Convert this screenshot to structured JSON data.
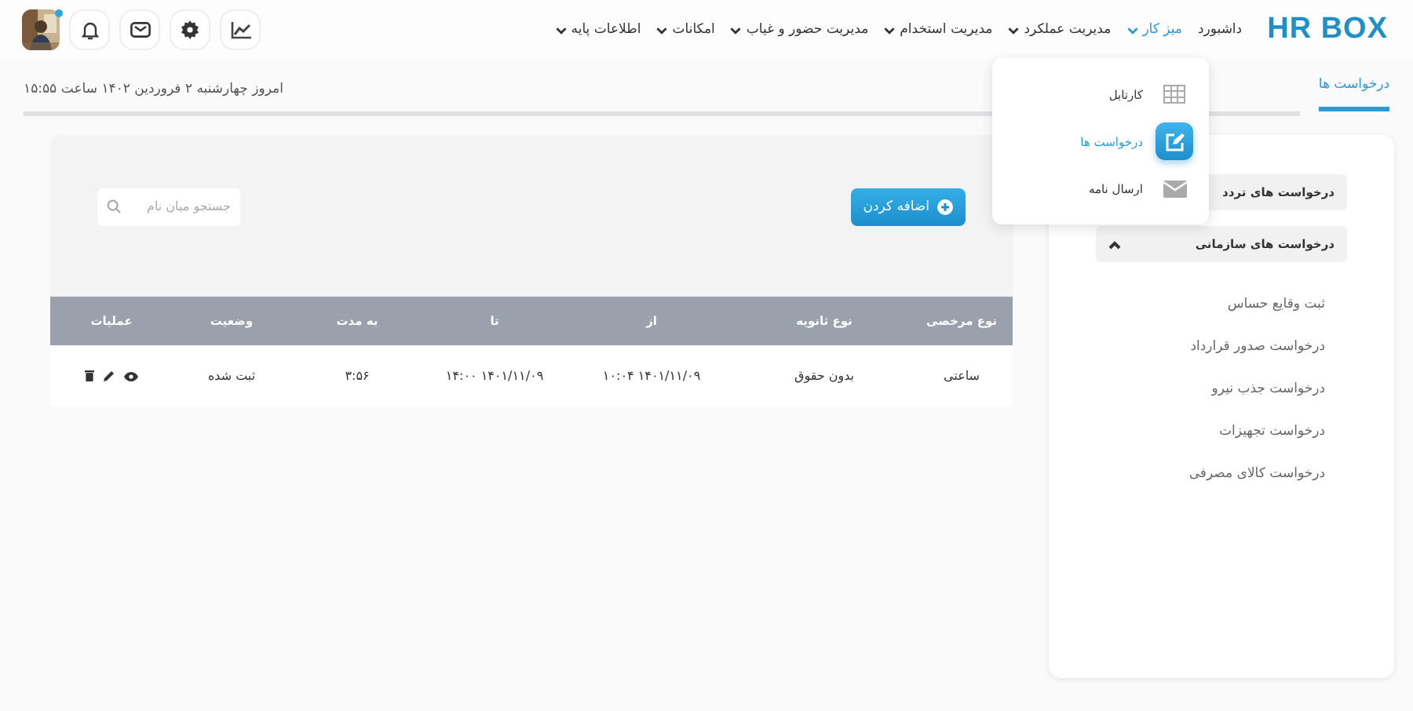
{
  "header": {
    "logo": "HR BOX",
    "nav": [
      {
        "label": "داشبورد",
        "selected": false,
        "dropdown": false
      },
      {
        "label": "میز کار",
        "selected": true,
        "dropdown": true
      },
      {
        "label": "مدیریت عملکرد",
        "selected": false,
        "dropdown": true
      },
      {
        "label": "مدیریت استخدام",
        "selected": false,
        "dropdown": true
      },
      {
        "label": "مدیریت حضور و غیاب",
        "selected": false,
        "dropdown": true
      },
      {
        "label": "امکانات",
        "selected": false,
        "dropdown": true
      },
      {
        "label": "اطلاعات پایه",
        "selected": false,
        "dropdown": true
      }
    ]
  },
  "menu": [
    {
      "label": "کارتابل",
      "kind": "grid",
      "selected": false
    },
    {
      "label": "درخواست ها",
      "kind": "edit",
      "selected": true
    },
    {
      "label": "ارسال نامه",
      "kind": "mail",
      "selected": false
    }
  ],
  "tabs": [
    {
      "label": "درخواست ها",
      "selected": true
    }
  ],
  "date": "امروز چهارشنبه ۲ فروردین ۱۴۰۲ ساعت ۱۵:۵۵",
  "sidebar": [
    {
      "label": "درخواست های تردد"
    },
    {
      "label": "درخواست های سازمانی",
      "expanded": true,
      "children": [
        "ثبت وقایع حساس",
        "درخواست صدور قرارداد",
        "درخواست جذب نیرو",
        "درخواست تجهیزات",
        "درخواست کالای مصرفی"
      ]
    }
  ],
  "add_button": "اضافه کردن",
  "search": {
    "placeholder": "جستجو میان نام"
  },
  "table": {
    "columns": [
      "نوع مرخصی",
      "نوع ثانویه",
      "از",
      "تا",
      "به مدت",
      "وضعیت",
      "عملیات"
    ],
    "rows": [
      [
        "ساعتی",
        "بدون حقوق",
        "۱۴۰۱/۱۱/۰۹ ۱۰:۰۴",
        "۱۴۰۱/۱۱/۰۹ ۱۴:۰۰",
        "۳:۵۶",
        "ثبت شده"
      ]
    ]
  }
}
